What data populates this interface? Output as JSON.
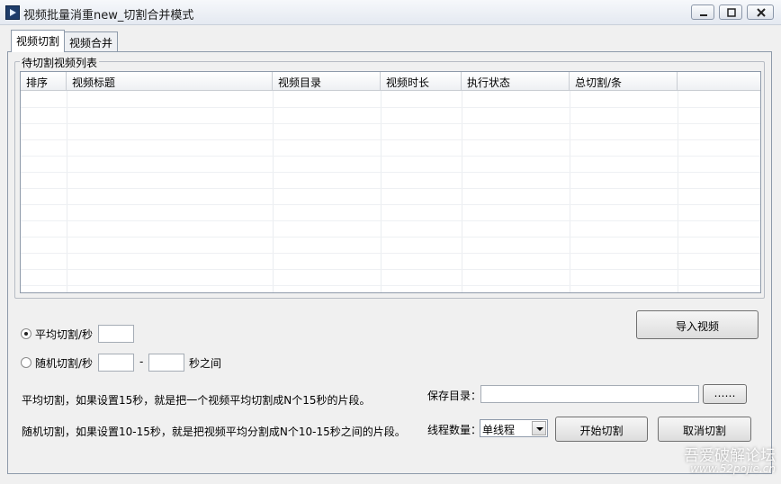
{
  "window": {
    "title": "视频批量消重new_切割合并模式"
  },
  "tabs": [
    {
      "label": "视频切割",
      "active": true
    },
    {
      "label": "视频合并",
      "active": false
    }
  ],
  "group": {
    "title": "待切割视频列表"
  },
  "table": {
    "columns": [
      "排序",
      "视频标题",
      "视频目录",
      "视频时长",
      "执行状态",
      "总切割/条"
    ],
    "rows": []
  },
  "controls": {
    "import_button": "导入视频",
    "avg_label": "平均切割/秒",
    "avg_value": "",
    "rand_label": "随机切割/秒",
    "rand_min": "",
    "rand_sep": "-",
    "rand_max": "",
    "rand_suffix": "秒之间",
    "avg_desc": "平均切割，如果设置15秒，就是把一个视频平均切割成N个15秒的片段。",
    "rand_desc": "随机切割，如果设置10-15秒，就是把视频平均分割成N个10-15秒之间的片段。",
    "save_dir_label": "保存目录：",
    "save_dir_value": "",
    "browse_button": "……",
    "threads_label": "线程数量：",
    "threads_value": "单线程",
    "start_button": "开始切割",
    "cancel_button": "取消切割"
  },
  "watermark": {
    "text": "吾爱破解论坛",
    "url": "www.52pojie.cn"
  }
}
